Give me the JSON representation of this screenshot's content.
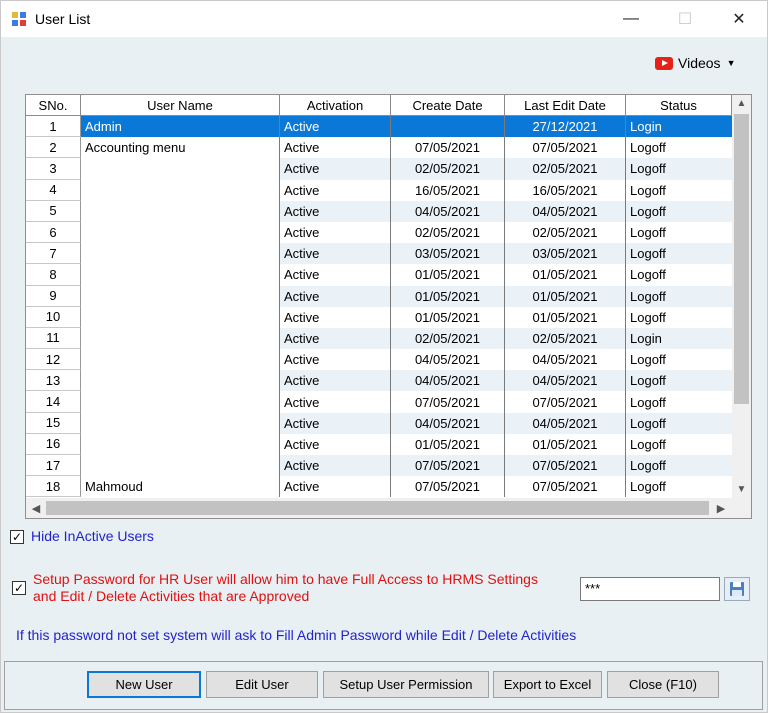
{
  "window": {
    "title": "User List"
  },
  "toolbar": {
    "videos_label": "Videos"
  },
  "grid": {
    "columns": [
      "SNo.",
      "User Name",
      "Activation",
      "Create Date",
      "Last Edit Date",
      "Status"
    ],
    "rows": [
      {
        "sno": "1",
        "name": "Admin",
        "activation": "Active",
        "create": "",
        "edit": "27/12/2021",
        "status": "Login"
      },
      {
        "sno": "2",
        "name": "Accounting menu",
        "activation": "Active",
        "create": "07/05/2021",
        "edit": "07/05/2021",
        "status": "Logoff"
      },
      {
        "sno": "3",
        "name": "",
        "activation": "Active",
        "create": "02/05/2021",
        "edit": "02/05/2021",
        "status": "Logoff"
      },
      {
        "sno": "4",
        "name": "",
        "activation": "Active",
        "create": "16/05/2021",
        "edit": "16/05/2021",
        "status": "Logoff"
      },
      {
        "sno": "5",
        "name": "",
        "activation": "Active",
        "create": "04/05/2021",
        "edit": "04/05/2021",
        "status": "Logoff"
      },
      {
        "sno": "6",
        "name": "",
        "activation": "Active",
        "create": "02/05/2021",
        "edit": "02/05/2021",
        "status": "Logoff"
      },
      {
        "sno": "7",
        "name": "",
        "activation": "Active",
        "create": "03/05/2021",
        "edit": "03/05/2021",
        "status": "Logoff"
      },
      {
        "sno": "8",
        "name": "",
        "activation": "Active",
        "create": "01/05/2021",
        "edit": "01/05/2021",
        "status": "Logoff"
      },
      {
        "sno": "9",
        "name": "",
        "activation": "Active",
        "create": "01/05/2021",
        "edit": "01/05/2021",
        "status": "Logoff"
      },
      {
        "sno": "10",
        "name": "",
        "activation": "Active",
        "create": "01/05/2021",
        "edit": "01/05/2021",
        "status": "Logoff"
      },
      {
        "sno": "11",
        "name": "",
        "activation": "Active",
        "create": "02/05/2021",
        "edit": "02/05/2021",
        "status": "Login"
      },
      {
        "sno": "12",
        "name": "",
        "activation": "Active",
        "create": "04/05/2021",
        "edit": "04/05/2021",
        "status": "Logoff"
      },
      {
        "sno": "13",
        "name": "",
        "activation": "Active",
        "create": "04/05/2021",
        "edit": "04/05/2021",
        "status": "Logoff"
      },
      {
        "sno": "14",
        "name": "",
        "activation": "Active",
        "create": "07/05/2021",
        "edit": "07/05/2021",
        "status": "Logoff"
      },
      {
        "sno": "15",
        "name": "",
        "activation": "Active",
        "create": "04/05/2021",
        "edit": "04/05/2021",
        "status": "Logoff"
      },
      {
        "sno": "16",
        "name": "",
        "activation": "Active",
        "create": "01/05/2021",
        "edit": "01/05/2021",
        "status": "Logoff"
      },
      {
        "sno": "17",
        "name": "",
        "activation": "Active",
        "create": "07/05/2021",
        "edit": "07/05/2021",
        "status": "Logoff"
      },
      {
        "sno": "18",
        "name": "Mahmoud",
        "activation": "Active",
        "create": "07/05/2021",
        "edit": "07/05/2021",
        "status": "Logoff"
      }
    ]
  },
  "options": {
    "hide_inactive_label": "Hide InActive Users",
    "hide_inactive_checked": true,
    "hr_password_label_line1": "Setup Password for HR User will allow him to have Full Access to HRMS Settings",
    "hr_password_label_line2": "and Edit / Delete  Activities that are Approved",
    "hr_password_checked": true,
    "password_value": "***",
    "info_text": "If this password not set system will ask to Fill Admin Password while Edit / Delete Activities"
  },
  "buttons": {
    "new_user": "New User",
    "edit_user": "Edit User",
    "setup_permission": "Setup User Permission",
    "export_excel": "Export to Excel",
    "close": "Close (F10)"
  }
}
